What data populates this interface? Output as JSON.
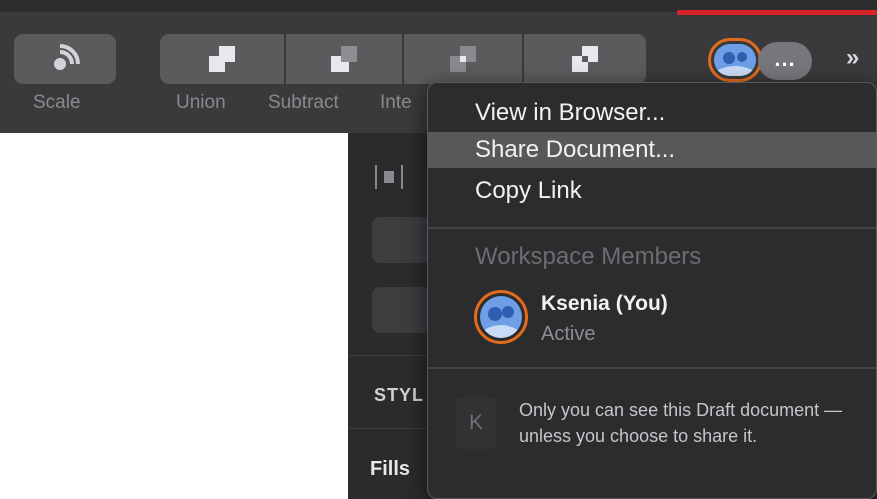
{
  "toolbar": {
    "scale_label": "Scale",
    "union_label": "Union",
    "subtract_label": "Subtract",
    "intersect_label": "Inte",
    "more_icon": "...",
    "overflow_icon": "»",
    "accent_color": "#d8232a"
  },
  "inspector": {
    "style_label": "STYL",
    "fills_label": "Fills"
  },
  "menu": {
    "items": [
      {
        "label": "View in Browser..."
      },
      {
        "label": "Share Document..."
      },
      {
        "label": "Copy Link"
      }
    ],
    "section_title": "Workspace Members",
    "member": {
      "name": "Ksenia (You)",
      "status": "Active"
    },
    "draft_badge": "K",
    "draft_note": "Only you can see this Draft document — unless you choose to share it."
  }
}
